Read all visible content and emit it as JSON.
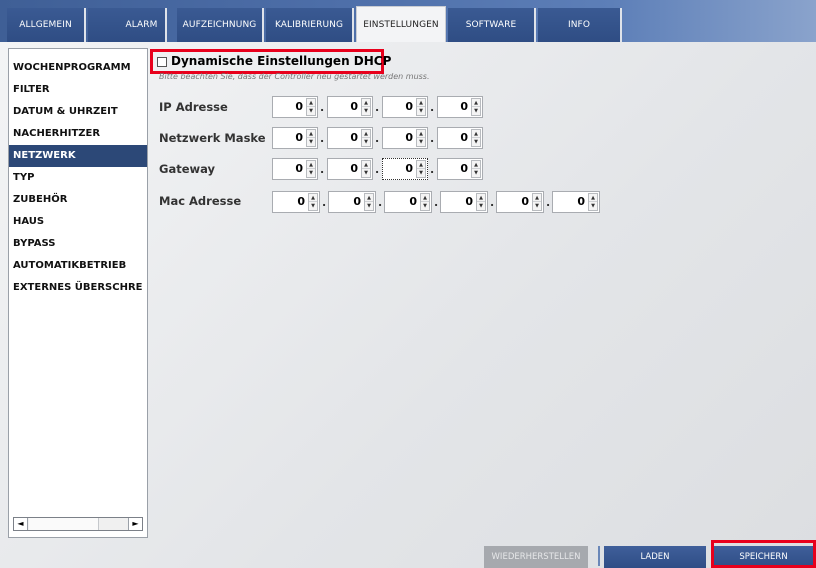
{
  "tabs": [
    {
      "label": "ALLGEMEIN"
    },
    {
      "label": "ALARM"
    },
    {
      "label": "AUFZEICHNUNG"
    },
    {
      "label": "KALIBRIERUNG"
    },
    {
      "label": "EINSTELLUNGEN",
      "active": true
    },
    {
      "label": "SOFTWARE"
    },
    {
      "label": "INFO"
    }
  ],
  "sidebar": {
    "items": [
      {
        "label": "WOCHENPROGRAMM"
      },
      {
        "label": "FILTER"
      },
      {
        "label": "DATUM & UHRZEIT"
      },
      {
        "label": "NACHERHITZER"
      },
      {
        "label": "NETZWERK",
        "selected": true
      },
      {
        "label": "TYP"
      },
      {
        "label": "ZUBEHÖR"
      },
      {
        "label": "HAUS"
      },
      {
        "label": "BYPASS"
      },
      {
        "label": "AUTOMATIKBETRIEB"
      },
      {
        "label": "EXTERNES ÜBERSCHRE"
      }
    ],
    "scroll_left": "◄",
    "scroll_right": "►"
  },
  "network": {
    "dhcp_label": "Dynamische Einstellungen DHCP",
    "dhcp_checked": false,
    "hint": "Bitte beachten Sie, dass der Controller neu gestartet werden muss.",
    "ip_label": "IP Adresse",
    "ip": [
      "0",
      "0",
      "0",
      "0"
    ],
    "mask_label": "Netzwerk Maske",
    "mask": [
      "0",
      "0",
      "0",
      "0"
    ],
    "gateway_label": "Gateway",
    "gateway": [
      "0",
      "0",
      "0",
      "0"
    ],
    "mac_label": "Mac Adresse",
    "mac": [
      "0",
      "0",
      "0",
      "0",
      "0",
      "0"
    ],
    "separator": "."
  },
  "buttons": {
    "restore": "WIEDERHERSTELLEN",
    "load": "LADEN",
    "save": "SPEICHERN"
  },
  "icons": {
    "spin_up": "▲",
    "spin_down": "▼"
  },
  "colors": {
    "accent": "#2c4877",
    "highlight": "#e8001c"
  }
}
